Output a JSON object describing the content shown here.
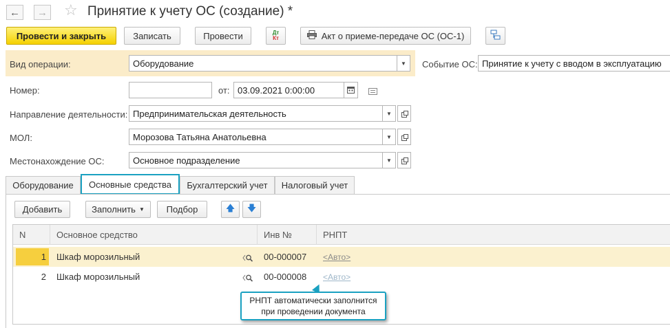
{
  "window": {
    "title": "Принятие к учету ОС (создание) *"
  },
  "toolbar": {
    "post_close_label": "Провести и закрыть",
    "save_label": "Записать",
    "post_label": "Провести",
    "dt_label": "Дт",
    "kt_label": "Кт",
    "act_label": "Акт о приеме-передаче ОС (ОС-1)"
  },
  "form": {
    "operation_label": "Вид операции:",
    "operation_value": "Оборудование",
    "event_label": "Событие ОС:",
    "event_value": "Принятие к учету с вводом в эксплуатацию",
    "number_label": "Номер:",
    "number_value": "",
    "date_label": "от:",
    "date_value": "03.09.2021  0:00:00",
    "direction_label": "Направление деятельности:",
    "direction_value": "Предпринимательская деятельность",
    "mol_label": "МОЛ:",
    "mol_value": "Морозова Татьяна Анатольевна",
    "location_label": "Местонахождение ОС:",
    "location_value": "Основное подразделение"
  },
  "tabs": [
    {
      "label": "Оборудование"
    },
    {
      "label": "Основные средства"
    },
    {
      "label": "Бухгалтерский учет"
    },
    {
      "label": "Налоговый учет"
    }
  ],
  "table_toolbar": {
    "add_label": "Добавить",
    "fill_label": "Заполнить",
    "pick_label": "Подбор"
  },
  "table": {
    "columns": [
      "N",
      "Основное средство",
      "Инв №",
      "РНПТ"
    ],
    "rows": [
      {
        "n": "1",
        "asset": "Шкаф морозильный",
        "inv": "00-000007",
        "rnpt": "<Авто>"
      },
      {
        "n": "2",
        "asset": "Шкаф морозильный",
        "inv": "00-000008",
        "rnpt": "<Авто>"
      }
    ]
  },
  "callout": {
    "line1": "РНПТ автоматически заполнится",
    "line2": "при проведении документа"
  },
  "colors": {
    "accent": "#1aa1c1",
    "primary_button": "#f5d100",
    "selected_row": "#fbf1cf",
    "operation_band": "#fbecc9"
  }
}
